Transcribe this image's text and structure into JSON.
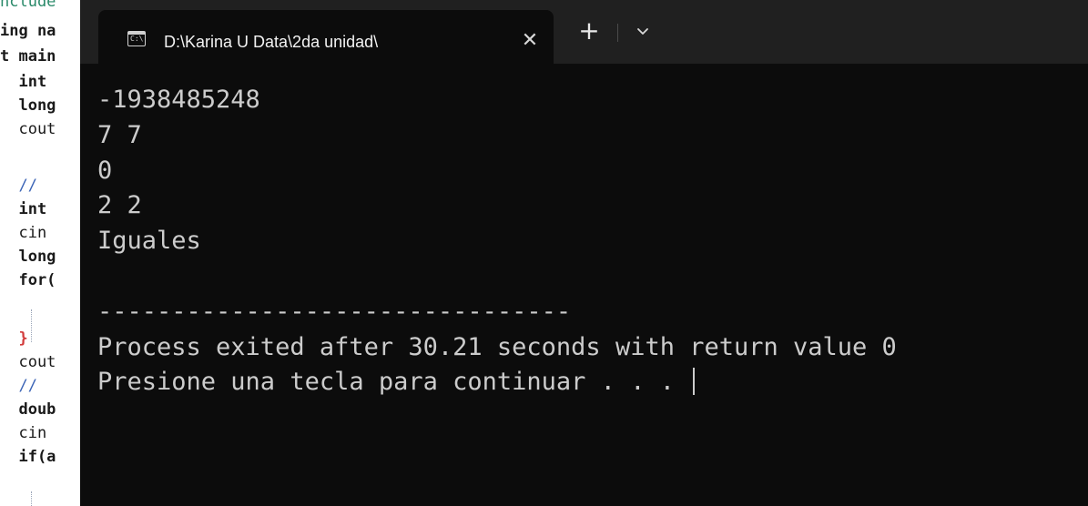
{
  "editor": {
    "lines": [
      {
        "text": "nclude",
        "cls": "green"
      },
      {
        "text": "ing na",
        "cls": "kw"
      },
      {
        "text": "t main",
        "cls": "kw"
      },
      {
        "text": "  int ",
        "cls": "kw"
      },
      {
        "text": "  long",
        "cls": "kw"
      },
      {
        "text": "  cout",
        "cls": "plain"
      },
      {
        "text": "",
        "cls": "plain"
      },
      {
        "text": "  //",
        "cls": "cmt"
      },
      {
        "text": "  int ",
        "cls": "kw"
      },
      {
        "text": "  cin ",
        "cls": "plain"
      },
      {
        "text": "  long",
        "cls": "kw"
      },
      {
        "text": "  for(",
        "cls": "kw"
      },
      {
        "text": "",
        "cls": "plain"
      },
      {
        "text": "  }",
        "cls": "red"
      },
      {
        "text": "  cout",
        "cls": "plain"
      },
      {
        "text": "  //",
        "cls": "cmt"
      },
      {
        "text": "  doub",
        "cls": "kw"
      },
      {
        "text": "  cin ",
        "cls": "plain"
      },
      {
        "text": "  if(a",
        "cls": "kw"
      }
    ]
  },
  "terminal": {
    "tab_title": "D:\\Karina U Data\\2da unidad\\",
    "icon_text": "C:\\",
    "close_glyph": "✕",
    "new_tab_glyph": "+",
    "output": [
      "-1938485248",
      "7 7",
      "0",
      "2 2",
      "Iguales",
      "",
      "--------------------------------",
      "Process exited after 30.21 seconds with return value 0",
      "Presione una tecla para continuar . . . "
    ]
  },
  "colors": {
    "console_bg": "#0c0c0c",
    "titlebar_bg": "#202020",
    "console_text": "#cccccc"
  }
}
